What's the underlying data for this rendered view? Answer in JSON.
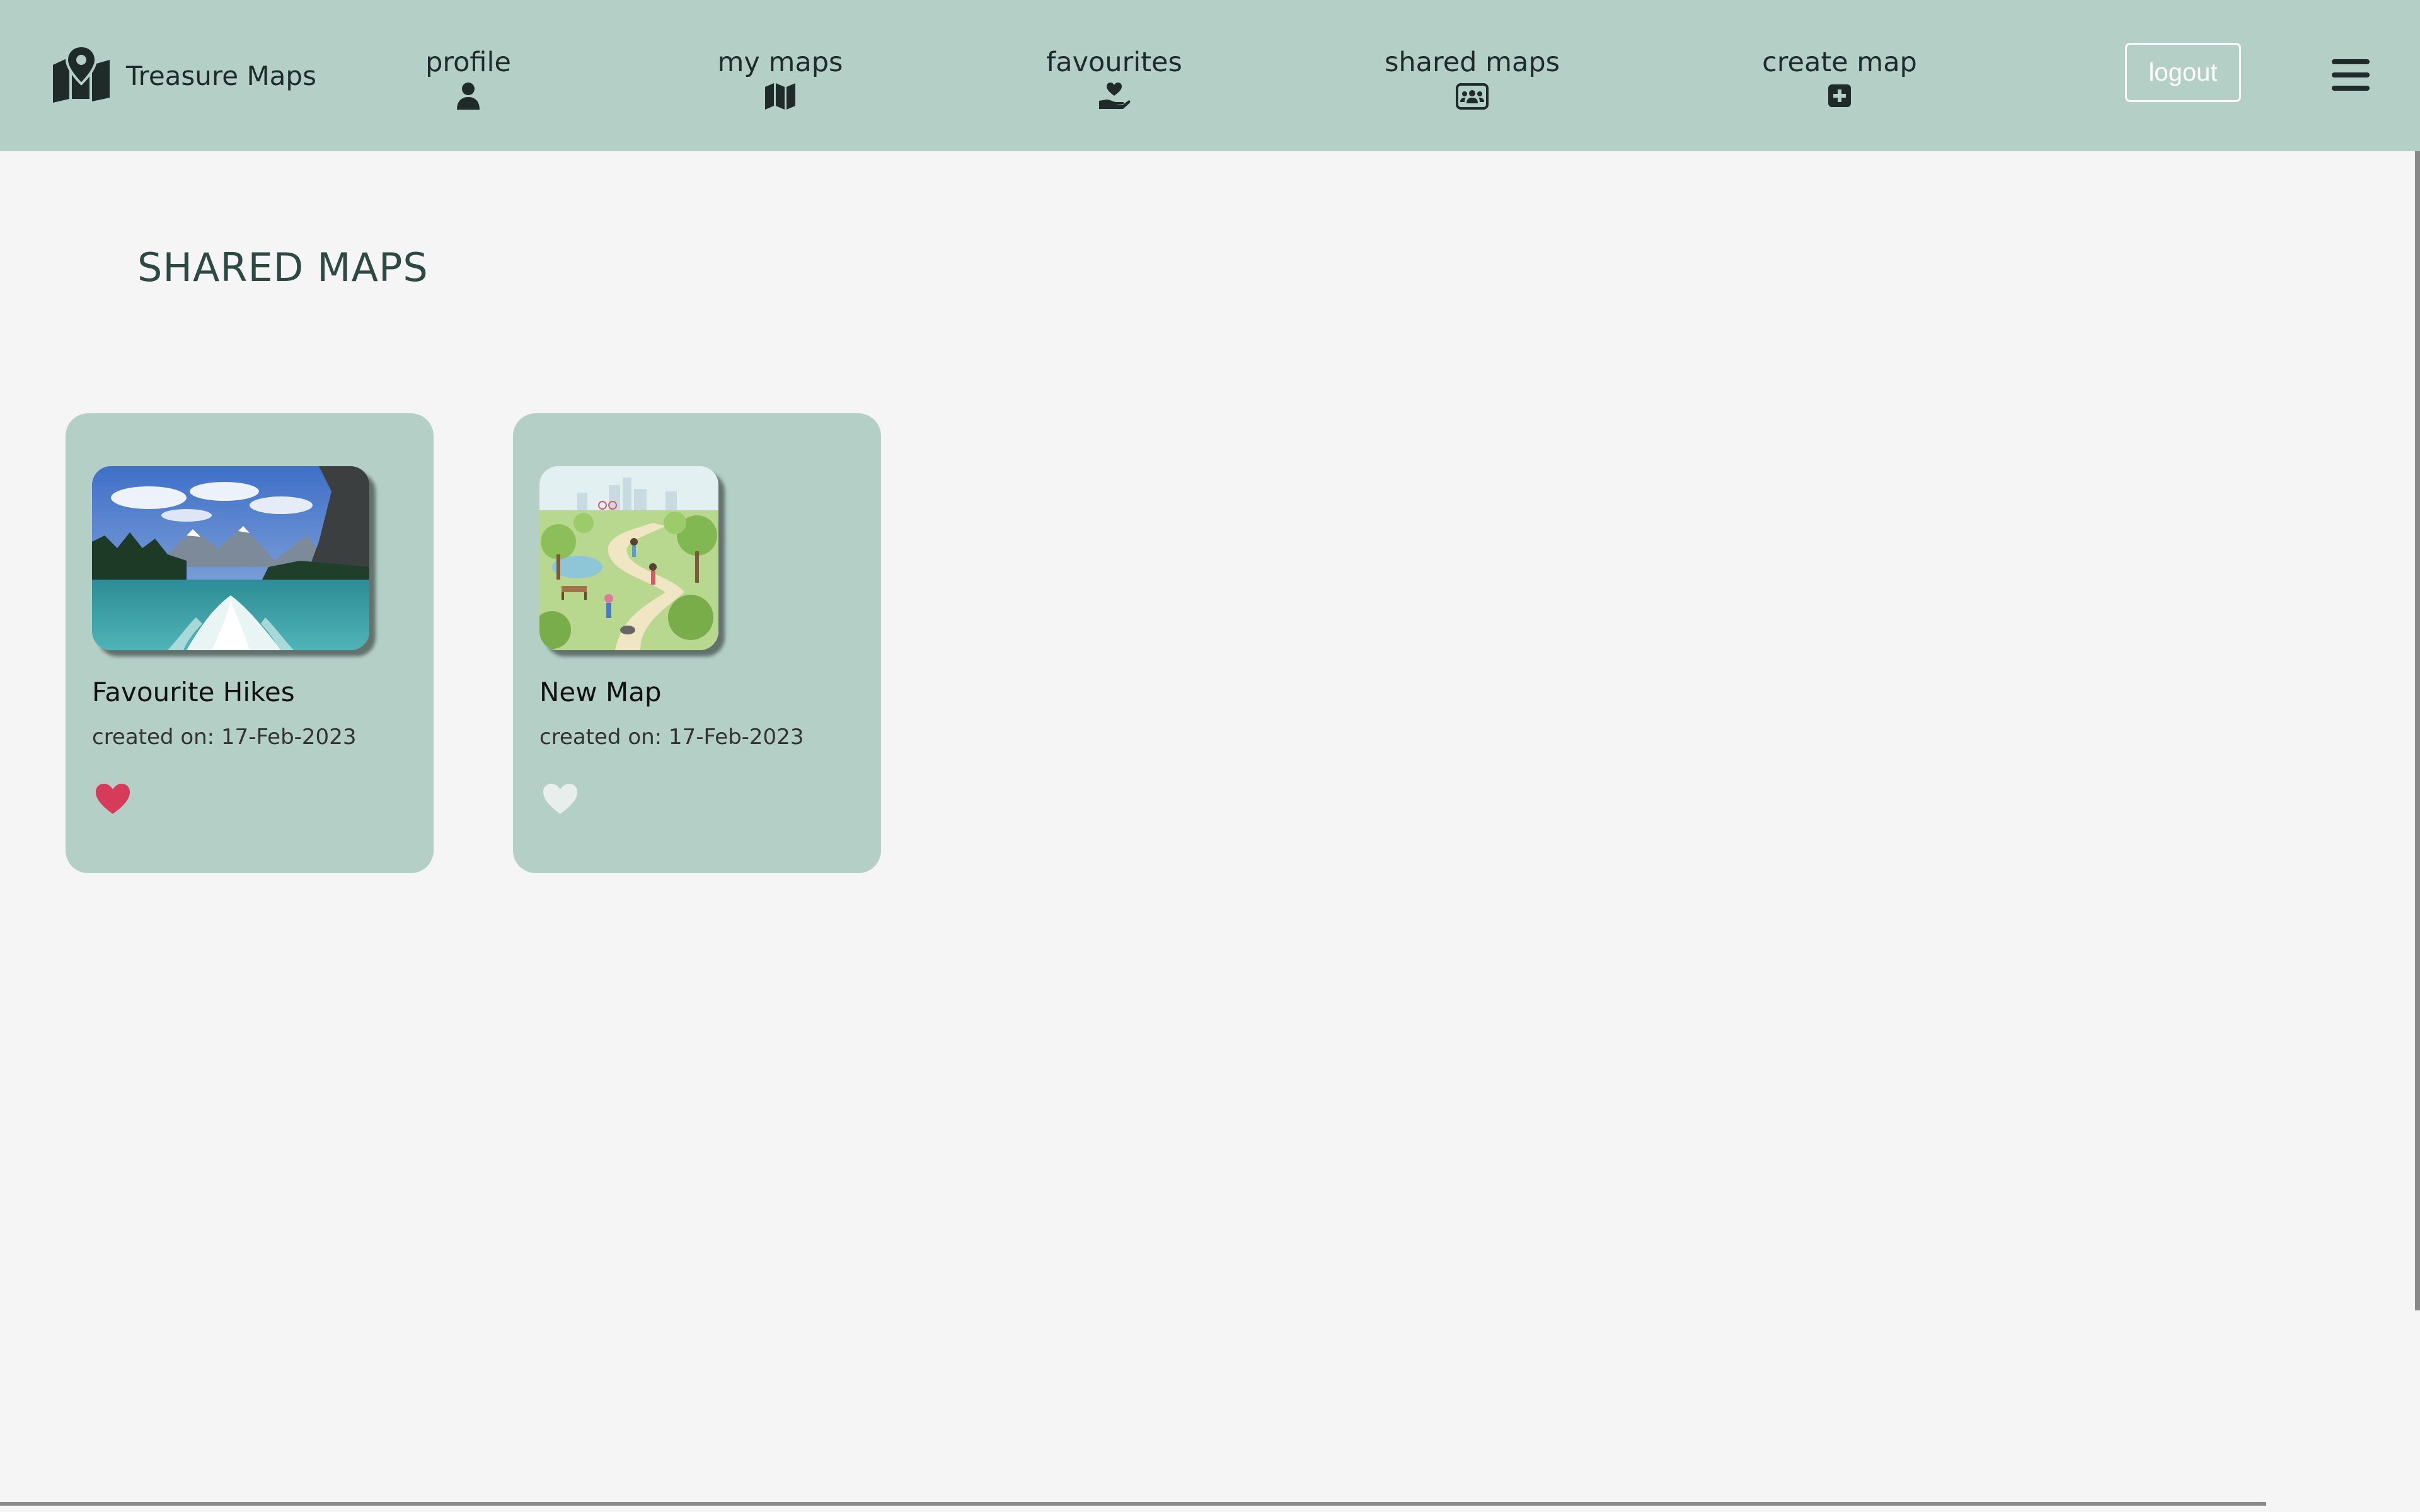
{
  "app": {
    "brand_name": "Treasure Maps",
    "brand_icon": "map-pin-icon"
  },
  "nav": {
    "items": [
      {
        "label": "profile",
        "icon": "user-icon"
      },
      {
        "label": "my maps",
        "icon": "map-icon"
      },
      {
        "label": "favourites",
        "icon": "hand-heart-icon"
      },
      {
        "label": "shared maps",
        "icon": "shared-users-icon"
      },
      {
        "label": "create map",
        "icon": "plus-square-icon"
      }
    ],
    "logout_label": "logout",
    "menu_icon": "hamburger-menu-icon"
  },
  "page": {
    "title": "SHARED MAPS"
  },
  "cards": [
    {
      "name": "Favourite Hikes",
      "created": "created on: 17-Feb-2023",
      "favourited": true,
      "image": "mountain-lake-photo"
    },
    {
      "name": "New Map",
      "created": "created on: 17-Feb-2023",
      "favourited": false,
      "image": "park-illustration"
    }
  ],
  "colors": {
    "nav_bg": "#b3cfc6",
    "card_bg": "#b3cfc6",
    "page_bg": "#f5f5f5",
    "heart_active": "#d63c5a",
    "heart_inactive": "#e8eeec",
    "title": "#2c4a42"
  }
}
